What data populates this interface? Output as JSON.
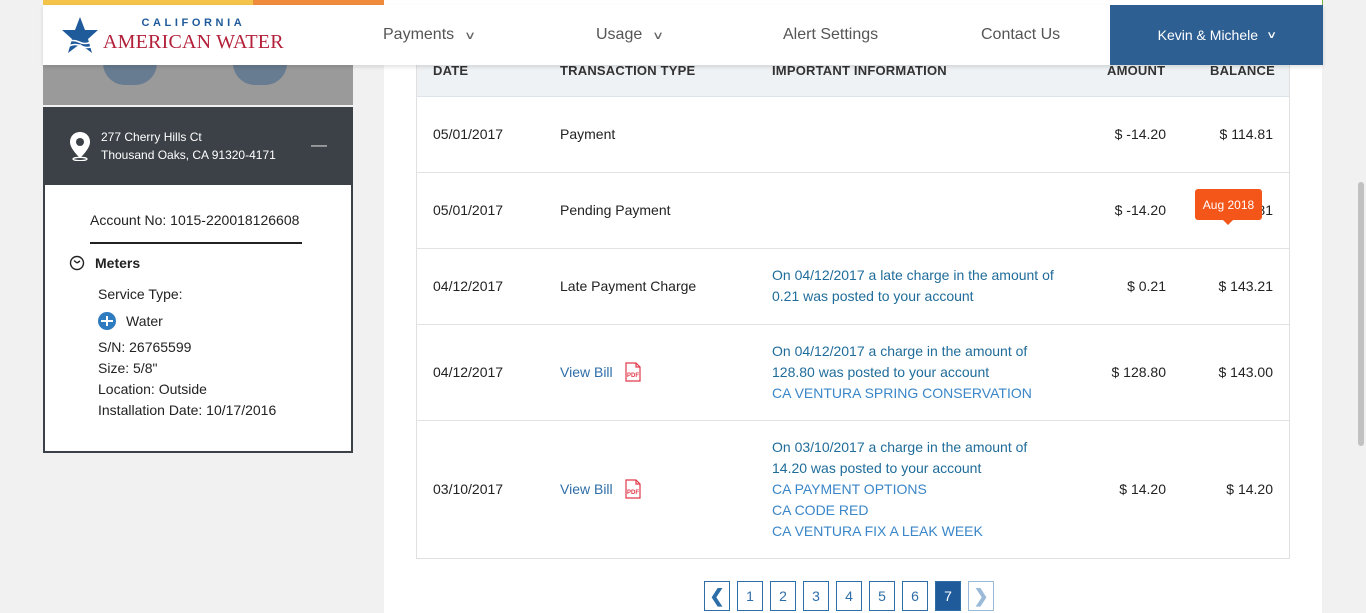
{
  "brand": {
    "line1": "CALIFORNIA",
    "line2": "AMERICAN WATER"
  },
  "nav": {
    "payments": "Payments",
    "usage": "Usage",
    "alert_settings": "Alert Settings",
    "contact_us": "Contact Us",
    "user": "Kevin & Michele"
  },
  "sidebar": {
    "address_line1": "277 Cherry Hills Ct",
    "address_line2": "Thousand Oaks, CA 91320-4171",
    "collapse_symbol": "—",
    "account_no": "Account No: 1015-220018126608",
    "meters_title": "Meters",
    "service_type_label": "Service Type:",
    "service_type": "Water",
    "serial": "S/N: 26765599",
    "size": "Size: 5/8\"",
    "location": "Location: Outside",
    "install_date": "Installation Date: 10/17/2016"
  },
  "table": {
    "headers": [
      "DATE",
      "TRANSACTION TYPE",
      "IMPORTANT INFORMATION",
      "AMOUNT",
      "BALANCE"
    ],
    "rows": [
      {
        "date": "05/01/2017",
        "type": "Payment",
        "info": [],
        "links": [],
        "amount": "$ -14.20",
        "balance": "$ 114.81"
      },
      {
        "date": "05/01/2017",
        "type": "Pending Payment",
        "info": [],
        "links": [],
        "amount": "$ -14.20",
        "balance": "$ 114.81"
      },
      {
        "date": "04/12/2017",
        "type": "Late Payment Charge",
        "info": [
          "On 04/12/2017 a late charge in the amount of",
          "0.21 was posted to your account"
        ],
        "links": [],
        "amount": "$ 0.21",
        "balance": "$ 143.21"
      },
      {
        "date": "04/12/2017",
        "type": "View Bill",
        "info": [
          "On 04/12/2017 a charge in the amount of",
          "128.80 was posted to your account"
        ],
        "links": [
          "CA VENTURA SPRING CONSERVATION"
        ],
        "amount": "$ 128.80",
        "balance": "$ 143.00"
      },
      {
        "date": "03/10/2017",
        "type": "View Bill",
        "info": [
          "On 03/10/2017 a charge in the amount of",
          "14.20 was posted to your account"
        ],
        "links": [
          "CA PAYMENT OPTIONS",
          "CA CODE RED",
          "CA VENTURA FIX A LEAK WEEK"
        ],
        "amount": "$ 14.20",
        "balance": "$ 14.20"
      }
    ],
    "pdf_label": "PDF"
  },
  "tooltip": "Aug 2018",
  "pagination": {
    "prev": "❮",
    "next": "❯",
    "pages": [
      "1",
      "2",
      "3",
      "4",
      "5",
      "6",
      "7"
    ],
    "current": "7"
  },
  "colors": {
    "brand_blue": "#1f5a9b",
    "brand_red": "#b3203a",
    "tooltip": "#f45519",
    "link": "#3a86c8"
  }
}
